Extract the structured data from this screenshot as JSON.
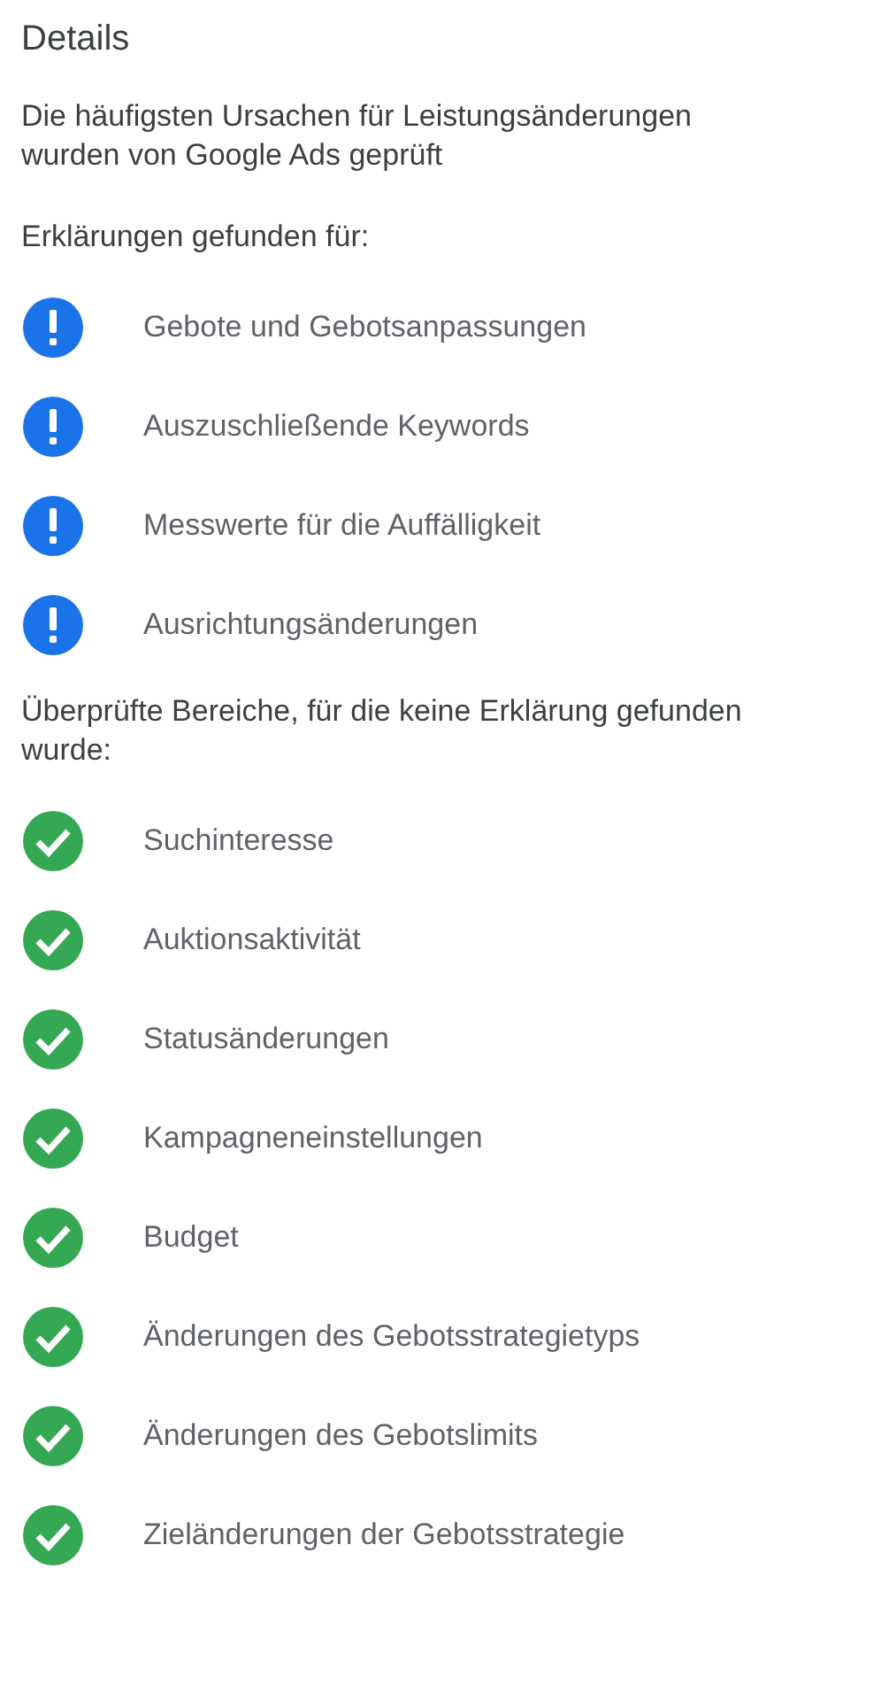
{
  "title": "Details",
  "intro": "Die häufigsten Ursachen für Leistungsänderungen wurden von Google Ads geprüft",
  "sections": [
    {
      "heading": "Erklärungen gefunden für:",
      "kind": "warning",
      "items": [
        "Gebote und Gebotsanpassungen",
        "Auszuschließende Keywords",
        "Messwerte für die Auffälligkeit",
        "Ausrichtungsänderungen"
      ]
    },
    {
      "heading": "Überprüfte Bereiche, für die keine Erklärung gefunden wurde:",
      "kind": "ok",
      "items": [
        "Suchinteresse",
        "Auktionsaktivität",
        "Statusänderungen",
        "Kampagneneinstellungen",
        "Budget",
        "Änderungen des Gebotsstrategietyps",
        "Änderungen des Gebotslimits",
        "Zieländerungen der Gebotsstrategie"
      ]
    }
  ]
}
